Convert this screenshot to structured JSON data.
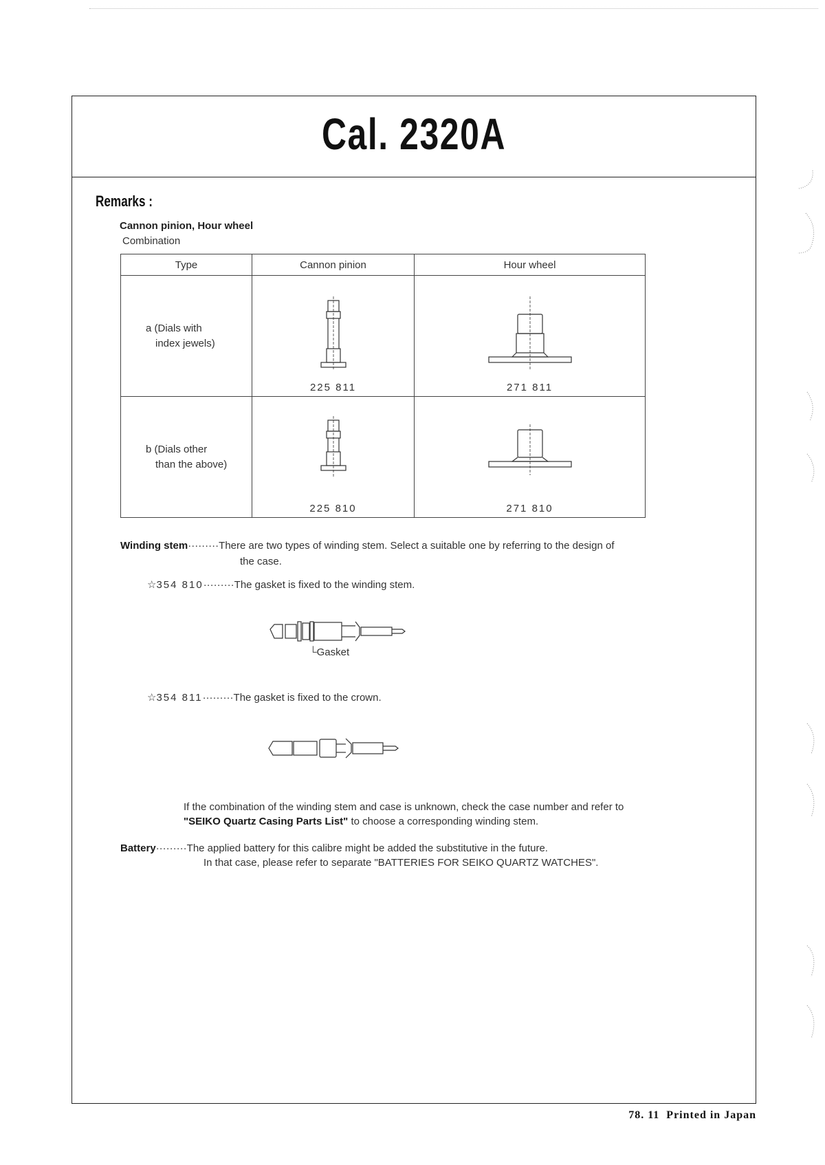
{
  "document": {
    "title": "Cal. 2320A",
    "section_heading": "Remarks :",
    "combination": {
      "heading": "Cannon pinion, Hour wheel",
      "subheading": "Combination",
      "columns": [
        "Type",
        "Cannon pinion",
        "Hour wheel"
      ],
      "rows": [
        {
          "type_line1": "a (Dials with",
          "type_line2": "index jewels)",
          "cannon_pinion_part": "225 811",
          "hour_wheel_part": "271 811",
          "cannon_pinion_icon": "cannon-pinion-drawing",
          "hour_wheel_icon": "hour-wheel-drawing"
        },
        {
          "type_line1": "b (Dials other",
          "type_line2": "than the above)",
          "cannon_pinion_part": "225 810",
          "hour_wheel_part": "271 810",
          "cannon_pinion_icon": "cannon-pinion-drawing",
          "hour_wheel_icon": "hour-wheel-drawing"
        }
      ]
    },
    "winding_stem": {
      "label": "Winding stem",
      "leader": "·········",
      "text_line1": "There are two types of winding stem. Select a suitable one by referring to the design of",
      "text_line2": "the case.",
      "variants": [
        {
          "star": "☆",
          "part": "354 810",
          "leader": "·········",
          "description": "The gasket is fixed to the winding stem.",
          "drawing_label": "Gasket",
          "icon": "winding-stem-with-gasket-drawing"
        },
        {
          "star": "☆",
          "part": "354 811",
          "leader": "·········",
          "description": "The gasket is fixed to the crown.",
          "icon": "winding-stem-drawing"
        }
      ],
      "note_line1": "If the combination of the winding stem and case is unknown, check the case number and refer to",
      "note_bold": "\"SEIKO Quartz Casing Parts List\"",
      "note_line2_rest": " to choose a corresponding winding stem."
    },
    "battery": {
      "label": "Battery",
      "leader": "·········",
      "text_line1": "The applied battery for this calibre might be added the substitutive in the future.",
      "text_line2": "In that case, please refer to separate \"BATTERIES FOR SEIKO QUARTZ WATCHES\"."
    },
    "footer": "78. 11  Printed in Japan"
  }
}
